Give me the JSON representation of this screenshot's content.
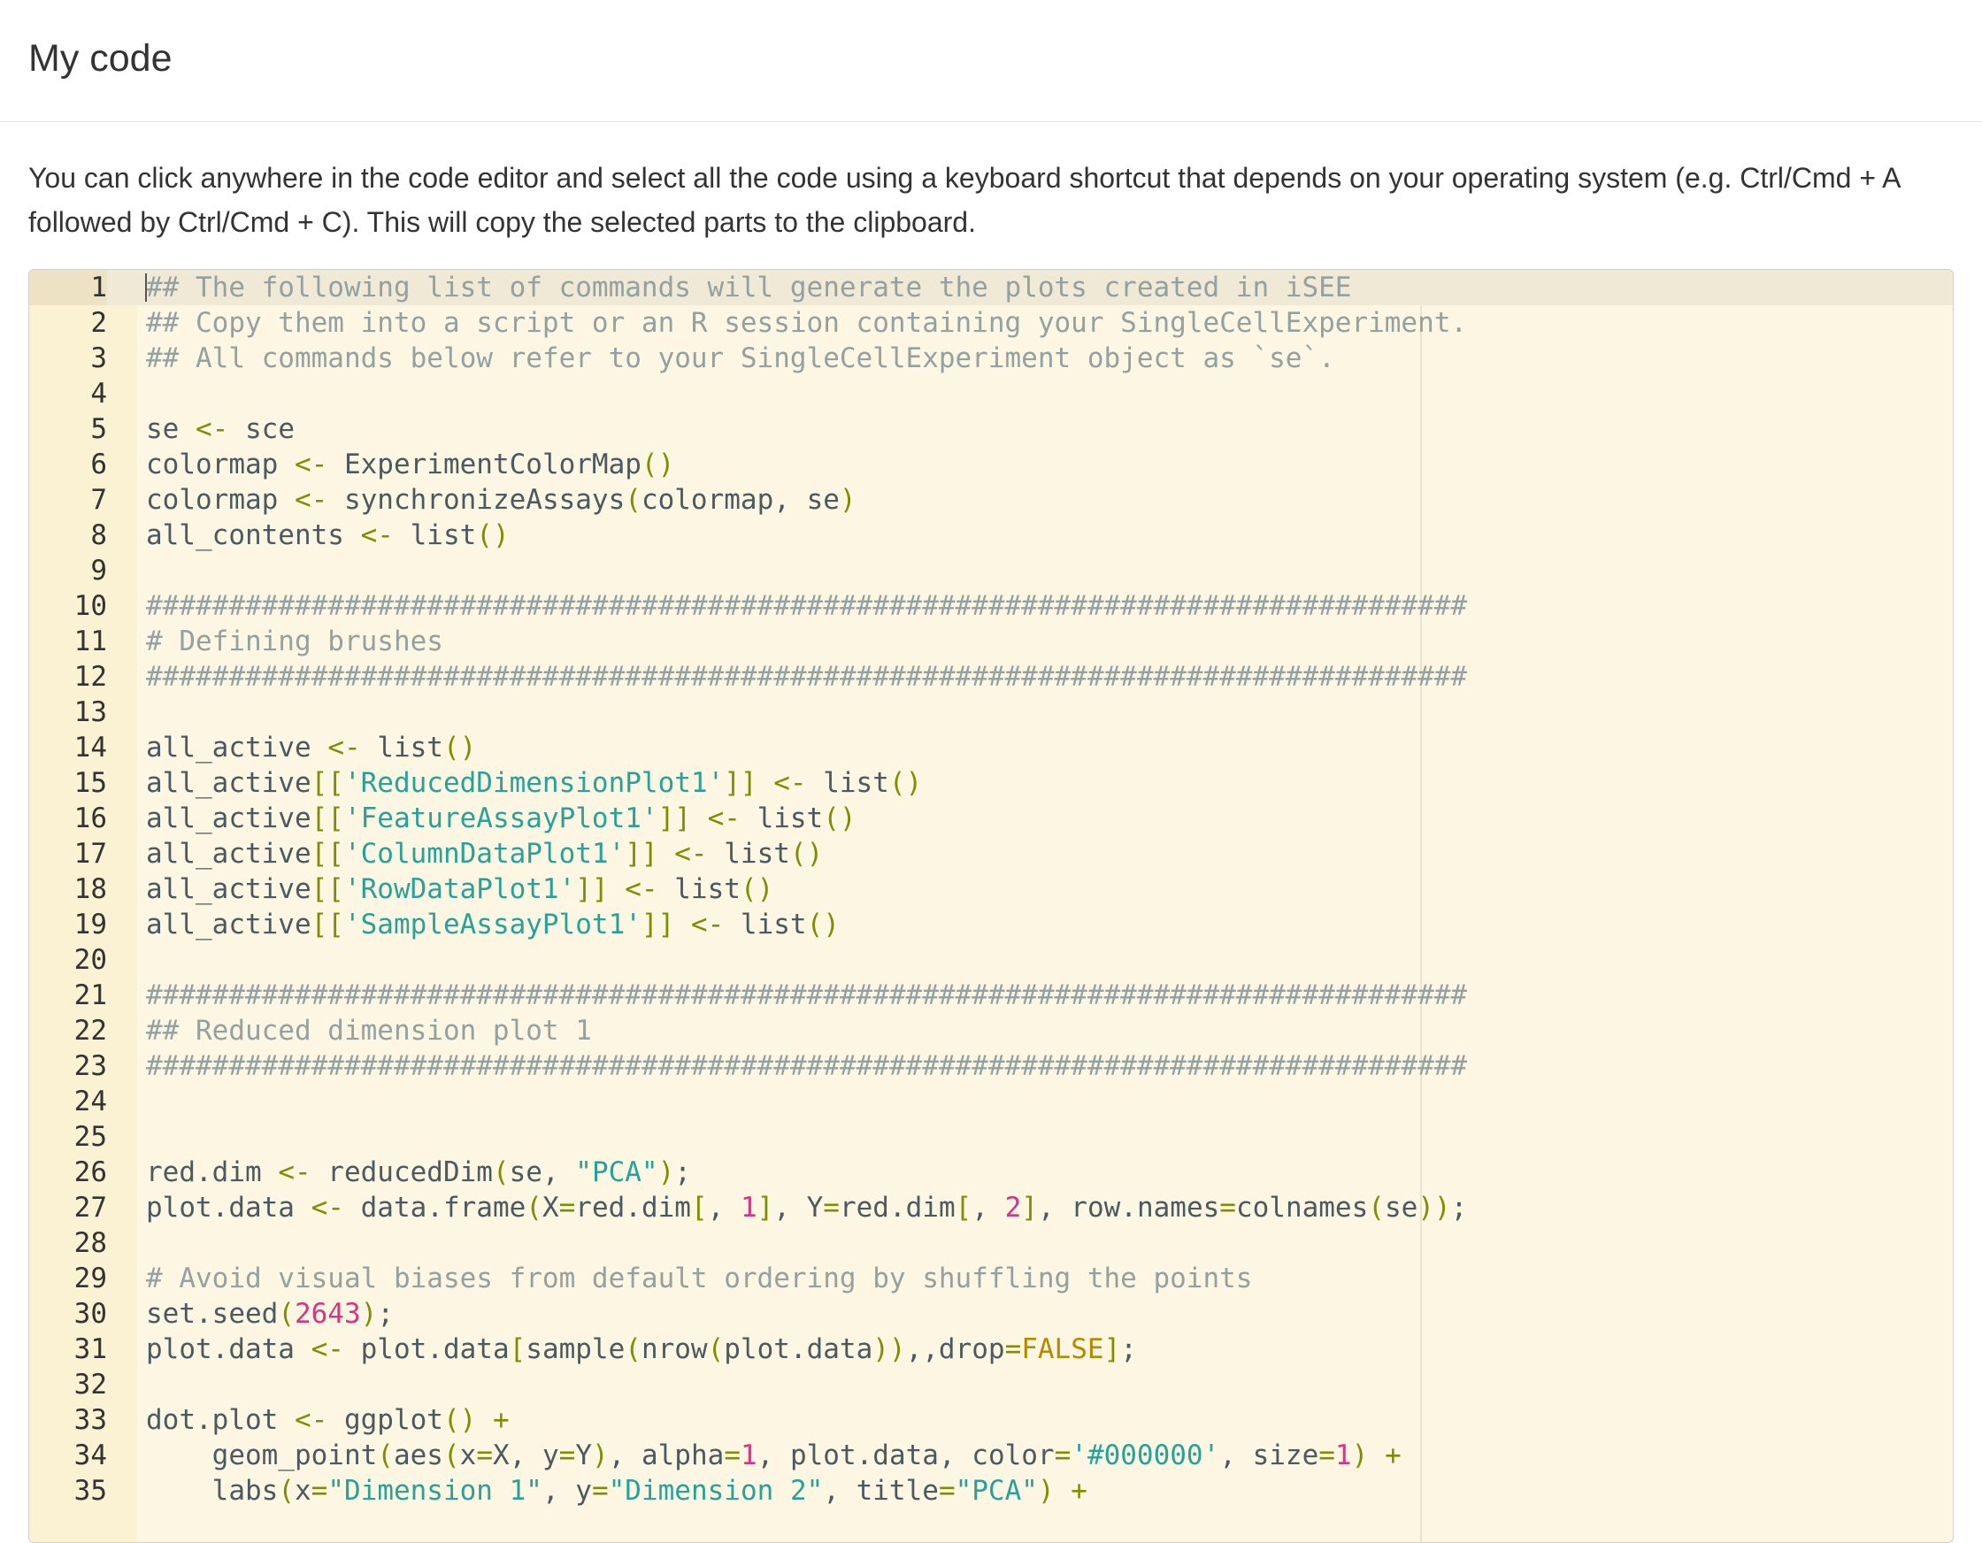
{
  "header": {
    "title": "My code"
  },
  "description": "You can click anywhere in the code editor and select all the code using a keyboard shortcut that depends on your operating system (e.g. Ctrl/Cmd + A followed by Ctrl/Cmd + C). This will copy the selected parts to the clipboard.",
  "editor": {
    "active_line": 1,
    "colors": {
      "background": "#fdf6e3",
      "gutter": "#fbf1d3",
      "comment": "#93a1a1",
      "string": "#2aa198",
      "number": "#d33682",
      "operator": "#7d8f00",
      "constant": "#b58900"
    },
    "lines": [
      [
        [
          "comment",
          "## The following list of commands will generate the plots created in iSEE"
        ]
      ],
      [
        [
          "comment",
          "## Copy them into a script or an R session containing your SingleCellExperiment."
        ]
      ],
      [
        [
          "comment",
          "## All commands below refer to your SingleCellExperiment object as `se`."
        ]
      ],
      [],
      [
        [
          "id",
          "se "
        ],
        [
          "kw",
          "<-"
        ],
        [
          "id",
          " sce"
        ]
      ],
      [
        [
          "id",
          "colormap "
        ],
        [
          "kw",
          "<-"
        ],
        [
          "id",
          " ExperimentColorMap"
        ],
        [
          "kw",
          "()"
        ]
      ],
      [
        [
          "id",
          "colormap "
        ],
        [
          "kw",
          "<-"
        ],
        [
          "id",
          " synchronizeAssays"
        ],
        [
          "kw",
          "("
        ],
        [
          "id",
          "colormap, se"
        ],
        [
          "kw",
          ")"
        ]
      ],
      [
        [
          "id",
          "all_contents "
        ],
        [
          "kw",
          "<-"
        ],
        [
          "id",
          " list"
        ],
        [
          "kw",
          "()"
        ]
      ],
      [],
      [
        [
          "comment",
          "################################################################################"
        ]
      ],
      [
        [
          "comment",
          "# Defining brushes"
        ]
      ],
      [
        [
          "comment",
          "################################################################################"
        ]
      ],
      [],
      [
        [
          "id",
          "all_active "
        ],
        [
          "kw",
          "<-"
        ],
        [
          "id",
          " list"
        ],
        [
          "kw",
          "()"
        ]
      ],
      [
        [
          "id",
          "all_active"
        ],
        [
          "kw",
          "[["
        ],
        [
          "str",
          "'ReducedDimensionPlot1'"
        ],
        [
          "kw",
          "]]"
        ],
        [
          "id",
          " "
        ],
        [
          "kw",
          "<-"
        ],
        [
          "id",
          " list"
        ],
        [
          "kw",
          "()"
        ]
      ],
      [
        [
          "id",
          "all_active"
        ],
        [
          "kw",
          "[["
        ],
        [
          "str",
          "'FeatureAssayPlot1'"
        ],
        [
          "kw",
          "]]"
        ],
        [
          "id",
          " "
        ],
        [
          "kw",
          "<-"
        ],
        [
          "id",
          " list"
        ],
        [
          "kw",
          "()"
        ]
      ],
      [
        [
          "id",
          "all_active"
        ],
        [
          "kw",
          "[["
        ],
        [
          "str",
          "'ColumnDataPlot1'"
        ],
        [
          "kw",
          "]]"
        ],
        [
          "id",
          " "
        ],
        [
          "kw",
          "<-"
        ],
        [
          "id",
          " list"
        ],
        [
          "kw",
          "()"
        ]
      ],
      [
        [
          "id",
          "all_active"
        ],
        [
          "kw",
          "[["
        ],
        [
          "str",
          "'RowDataPlot1'"
        ],
        [
          "kw",
          "]]"
        ],
        [
          "id",
          " "
        ],
        [
          "kw",
          "<-"
        ],
        [
          "id",
          " list"
        ],
        [
          "kw",
          "()"
        ]
      ],
      [
        [
          "id",
          "all_active"
        ],
        [
          "kw",
          "[["
        ],
        [
          "str",
          "'SampleAssayPlot1'"
        ],
        [
          "kw",
          "]]"
        ],
        [
          "id",
          " "
        ],
        [
          "kw",
          "<-"
        ],
        [
          "id",
          " list"
        ],
        [
          "kw",
          "()"
        ]
      ],
      [],
      [
        [
          "comment",
          "################################################################################"
        ]
      ],
      [
        [
          "comment",
          "## Reduced dimension plot 1"
        ]
      ],
      [
        [
          "comment",
          "################################################################################"
        ]
      ],
      [],
      [],
      [
        [
          "id",
          "red.dim "
        ],
        [
          "kw",
          "<-"
        ],
        [
          "id",
          " reducedDim"
        ],
        [
          "kw",
          "("
        ],
        [
          "id",
          "se, "
        ],
        [
          "str",
          "\"PCA\""
        ],
        [
          "kw",
          ")"
        ],
        [
          "id",
          ";"
        ]
      ],
      [
        [
          "id",
          "plot.data "
        ],
        [
          "kw",
          "<-"
        ],
        [
          "id",
          " data.frame"
        ],
        [
          "kw",
          "("
        ],
        [
          "id",
          "X"
        ],
        [
          "kw",
          "="
        ],
        [
          "id",
          "red.dim"
        ],
        [
          "kw",
          "["
        ],
        [
          "id",
          ", "
        ],
        [
          "num",
          "1"
        ],
        [
          "kw",
          "]"
        ],
        [
          "id",
          ", Y"
        ],
        [
          "kw",
          "="
        ],
        [
          "id",
          "red.dim"
        ],
        [
          "kw",
          "["
        ],
        [
          "id",
          ", "
        ],
        [
          "num",
          "2"
        ],
        [
          "kw",
          "]"
        ],
        [
          "id",
          ", row.names"
        ],
        [
          "kw",
          "="
        ],
        [
          "id",
          "colnames"
        ],
        [
          "kw",
          "("
        ],
        [
          "id",
          "se"
        ],
        [
          "kw",
          "))"
        ],
        [
          "id",
          ";"
        ]
      ],
      [],
      [
        [
          "comment",
          "# Avoid visual biases from default ordering by shuffling the points"
        ]
      ],
      [
        [
          "id",
          "set.seed"
        ],
        [
          "kw",
          "("
        ],
        [
          "num",
          "2643"
        ],
        [
          "kw",
          ")"
        ],
        [
          "id",
          ";"
        ]
      ],
      [
        [
          "id",
          "plot.data "
        ],
        [
          "kw",
          "<-"
        ],
        [
          "id",
          " plot.data"
        ],
        [
          "kw",
          "["
        ],
        [
          "id",
          "sample"
        ],
        [
          "kw",
          "("
        ],
        [
          "id",
          "nrow"
        ],
        [
          "kw",
          "("
        ],
        [
          "id",
          "plot.data"
        ],
        [
          "kw",
          "))"
        ],
        [
          "id",
          ",,drop"
        ],
        [
          "kw",
          "="
        ],
        [
          "bool",
          "FALSE"
        ],
        [
          "kw",
          "]"
        ],
        [
          "id",
          ";"
        ]
      ],
      [],
      [
        [
          "id",
          "dot.plot "
        ],
        [
          "kw",
          "<-"
        ],
        [
          "id",
          " ggplot"
        ],
        [
          "kw",
          "()"
        ],
        [
          "id",
          " "
        ],
        [
          "kw",
          "+"
        ]
      ],
      [
        [
          "id",
          "    geom_point"
        ],
        [
          "kw",
          "("
        ],
        [
          "id",
          "aes"
        ],
        [
          "kw",
          "("
        ],
        [
          "id",
          "x"
        ],
        [
          "kw",
          "="
        ],
        [
          "id",
          "X, y"
        ],
        [
          "kw",
          "="
        ],
        [
          "id",
          "Y"
        ],
        [
          "kw",
          ")"
        ],
        [
          "id",
          ", alpha"
        ],
        [
          "kw",
          "="
        ],
        [
          "num",
          "1"
        ],
        [
          "id",
          ", plot.data, color"
        ],
        [
          "kw",
          "="
        ],
        [
          "str",
          "'#000000'"
        ],
        [
          "id",
          ", size"
        ],
        [
          "kw",
          "="
        ],
        [
          "num",
          "1"
        ],
        [
          "kw",
          ")"
        ],
        [
          "id",
          " "
        ],
        [
          "kw",
          "+"
        ]
      ],
      [
        [
          "id",
          "    labs"
        ],
        [
          "kw",
          "("
        ],
        [
          "id",
          "x"
        ],
        [
          "kw",
          "="
        ],
        [
          "str",
          "\"Dimension 1\""
        ],
        [
          "id",
          ", y"
        ],
        [
          "kw",
          "="
        ],
        [
          "str",
          "\"Dimension 2\""
        ],
        [
          "id",
          ", title"
        ],
        [
          "kw",
          "="
        ],
        [
          "str",
          "\"PCA\""
        ],
        [
          "kw",
          ")"
        ],
        [
          "id",
          " "
        ],
        [
          "kw",
          "+"
        ]
      ]
    ]
  }
}
